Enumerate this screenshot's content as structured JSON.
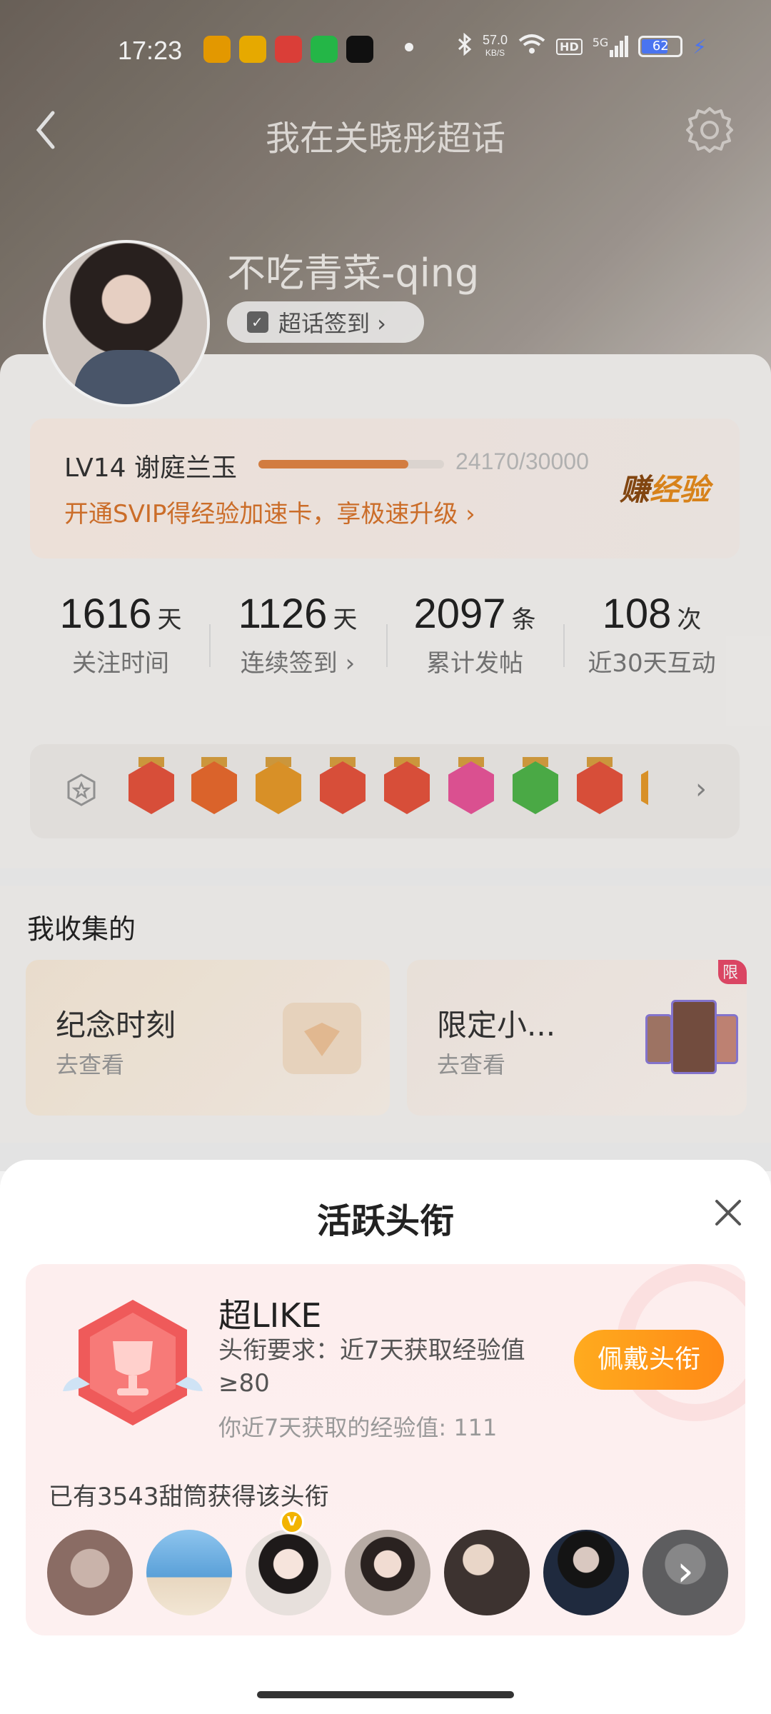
{
  "status_bar": {
    "time": "17:23",
    "net_speed_value": "57.0",
    "net_speed_unit": "KB/S",
    "hd_label": "HD",
    "signal_label": "5G",
    "battery": "62",
    "app_icon_colors": [
      "#f2a200",
      "#f5b400",
      "#e8423c",
      "#27c24c",
      "#111111"
    ]
  },
  "nav": {
    "title": "我在关晓彤超话",
    "back_icon": "chevron-left-icon",
    "settings_icon": "gear-icon"
  },
  "profile": {
    "username": "不吃青菜-qing",
    "checkin_label": "超话签到 ›"
  },
  "level": {
    "title": "LV14 谢庭兰玉",
    "current": 24170,
    "max": 30000,
    "progress_text": "24170/30000",
    "progress_fraction": 0.806,
    "promo": "开通SVIP得经验加速卡，享极速升级 ›",
    "earn_label_a": "赚",
    "earn_label_b": "经验"
  },
  "stats": [
    {
      "num": "1616",
      "unit": "天",
      "label": "关注时间"
    },
    {
      "num": "1126",
      "unit": "天",
      "label": "连续签到 ›"
    },
    {
      "num": "2097",
      "unit": "条",
      "label": "累计发帖"
    },
    {
      "num": "108",
      "unit": "次",
      "label": "近30天互动"
    }
  ],
  "badges_row": {
    "more_label": "›",
    "badge_colors": [
      "#e5533d",
      "#e86a2e",
      "#e69a2a",
      "#e5533d",
      "#e5533d",
      "#e8559a",
      "#4fb44a",
      "#e5533d"
    ]
  },
  "collect": {
    "heading": "我收集的",
    "cards": [
      {
        "title": "纪念时刻",
        "sub": "去查看"
      },
      {
        "title": "限定小...",
        "sub": "去查看",
        "tag": "限"
      }
    ]
  },
  "sheet": {
    "title": "活跃头衔",
    "badge_name": "超LIKE",
    "requirement": "头衔要求：近7天获取经验值≥80",
    "mine": "你近7天获取的经验值: 111",
    "wear_button": "佩戴头衔",
    "owners_text": "已有3543甜筒获得该头衔",
    "more_avatars": "›",
    "avatar_colors": [
      "#8a6c64",
      "#5aa0d8",
      "#e7e0dc",
      "#b7aba4",
      "#3d3330",
      "#1f2a3e",
      "#8f8f93"
    ]
  },
  "colors": {
    "accent_orange": "#e08445",
    "button_orange": "#ff9a1a",
    "sheet_card_bg": "#fdeeee"
  }
}
